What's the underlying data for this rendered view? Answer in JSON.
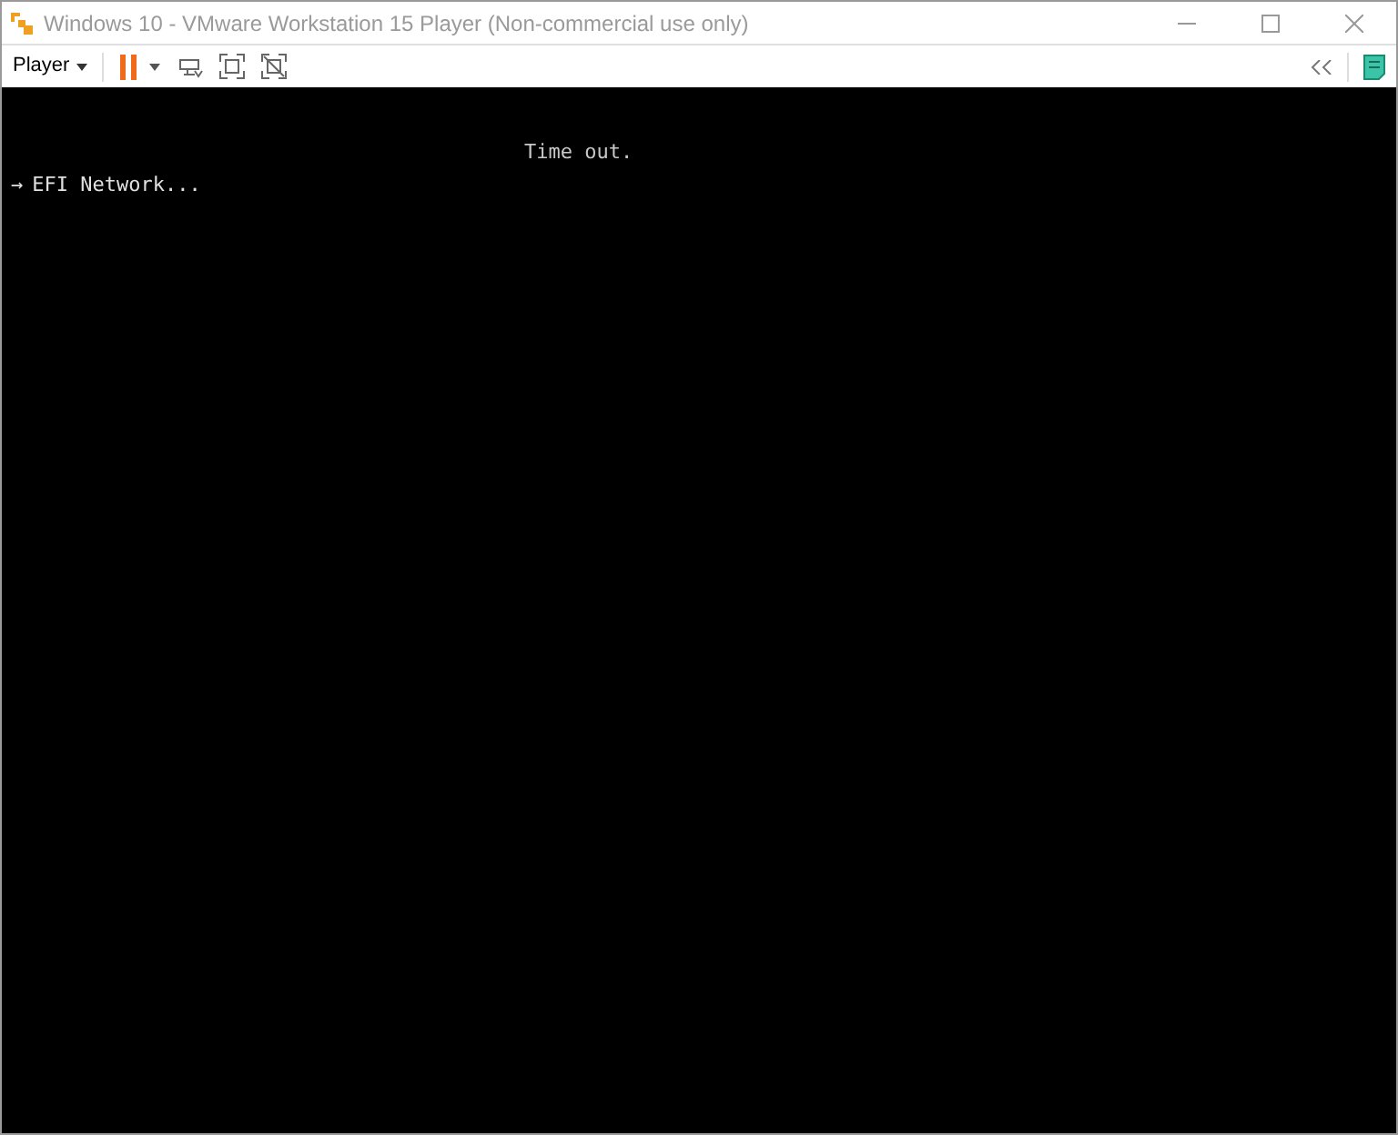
{
  "window": {
    "title": "Windows 10 - VMware Workstation 15 Player (Non-commercial use only)"
  },
  "toolbar": {
    "menu": "Player"
  },
  "console": {
    "message": "Time out.",
    "boot_entries": [
      {
        "marker": "→",
        "label": "EFI Network...",
        "selected": true
      }
    ]
  }
}
